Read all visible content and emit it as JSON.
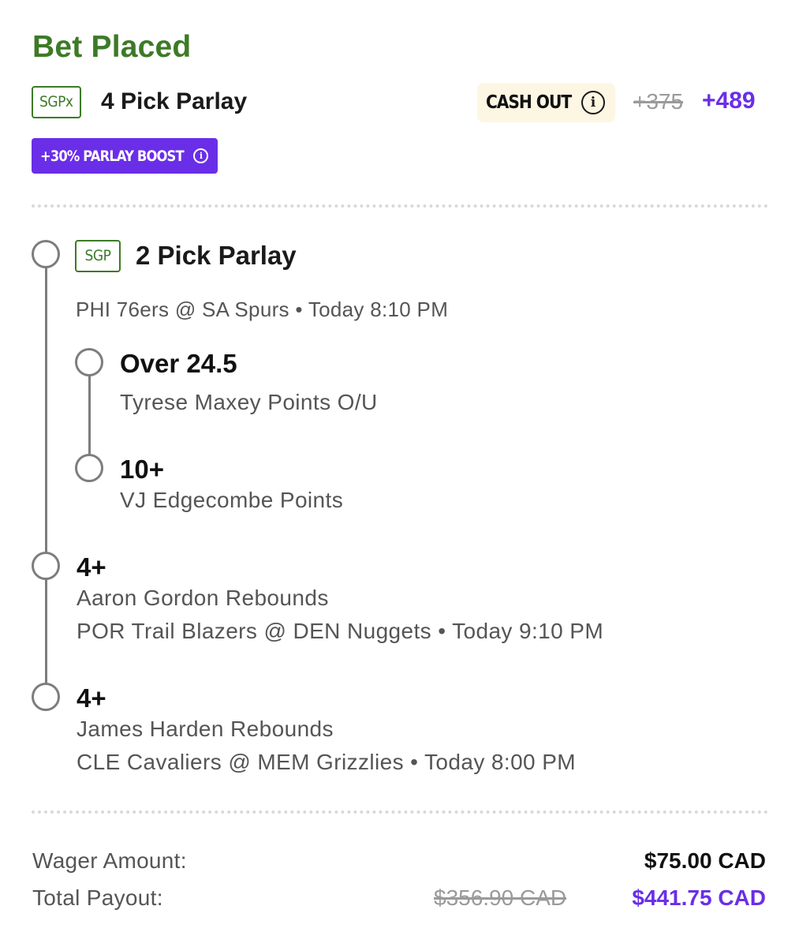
{
  "header": {
    "title": "Bet Placed",
    "bet_type_badge": "SGPx",
    "bet_title": "4 Pick Parlay",
    "cash_out_label": "CASH OUT",
    "old_odds": "+375",
    "new_odds": "+489",
    "boost_label": "+30% PARLAY BOOST"
  },
  "legs": {
    "sgp": {
      "badge": "SGP",
      "title": "2 Pick Parlay",
      "game": "PHI 76ers @ SA Spurs • Today 8:10 PM",
      "picks": [
        {
          "selection": "Over 24.5",
          "market": "Tyrese Maxey Points O/U"
        },
        {
          "selection": "10+",
          "market": "VJ Edgecombe Points"
        }
      ]
    },
    "singles": [
      {
        "selection": "4+",
        "market": "Aaron Gordon Rebounds",
        "game": "POR Trail Blazers @ DEN Nuggets • Today 9:10 PM"
      },
      {
        "selection": "4+",
        "market": "James Harden Rebounds",
        "game": "CLE Cavaliers @ MEM Grizzlies • Today 8:00 PM"
      }
    ]
  },
  "summary": {
    "wager_label": "Wager Amount:",
    "wager_value": "$75.00 CAD",
    "payout_label": "Total Payout:",
    "payout_old": "$356.90 CAD",
    "payout_new": "$441.75 CAD"
  },
  "colors": {
    "brand_green": "#3d7a27",
    "boost_purple": "#6a2ee8",
    "cashout_bg": "#fdf6e3",
    "muted_text": "#555555",
    "strike_gray": "#9a9a9a"
  }
}
